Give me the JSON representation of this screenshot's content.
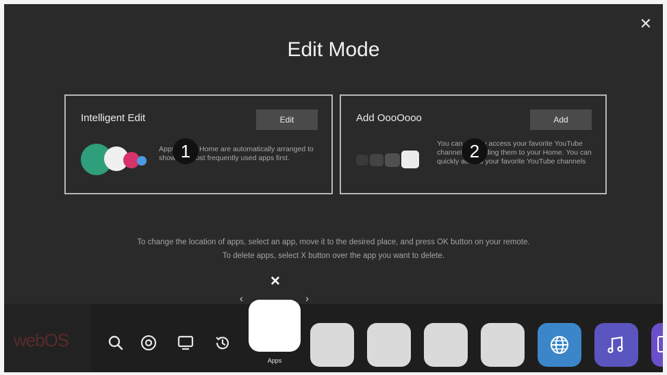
{
  "header": {
    "title": "Edit Mode",
    "close_icon": "close-icon"
  },
  "cards": [
    {
      "title": "Intelligent Edit",
      "button_label": "Edit",
      "badge": "1",
      "description": "Apps on the Home are automatically arranged to show the most frequently used apps first."
    },
    {
      "title": "Add OooOooo",
      "button_label": "Add",
      "badge": "2",
      "description": "You can quickly access your favorite YouTube channels by adding them to your Home. You can quickly access your favorite YouTube channels"
    }
  ],
  "instructions": {
    "line1": "To change the location of apps, select an app, move it to the desired place, and press OK button on your remote.",
    "line2": "To delete apps, select X button over the app you want to delete."
  },
  "dock": {
    "logo": "webOS",
    "selected_label": "Apps",
    "icons": [
      "search-icon",
      "input-source-icon",
      "tv-icon",
      "recent-icon"
    ],
    "apps": [
      "blank-app",
      "blank-app",
      "blank-app",
      "blank-app",
      "globe-icon",
      "music-icon",
      "gallery-icon"
    ]
  },
  "colors": {
    "background": "#2a2a2a",
    "dock": "#1e1e1e",
    "green": "#2f9e7a",
    "pink": "#d6336c",
    "blue": "#4a9be0",
    "globe": "#3b86c8",
    "music": "#5b55bf"
  }
}
